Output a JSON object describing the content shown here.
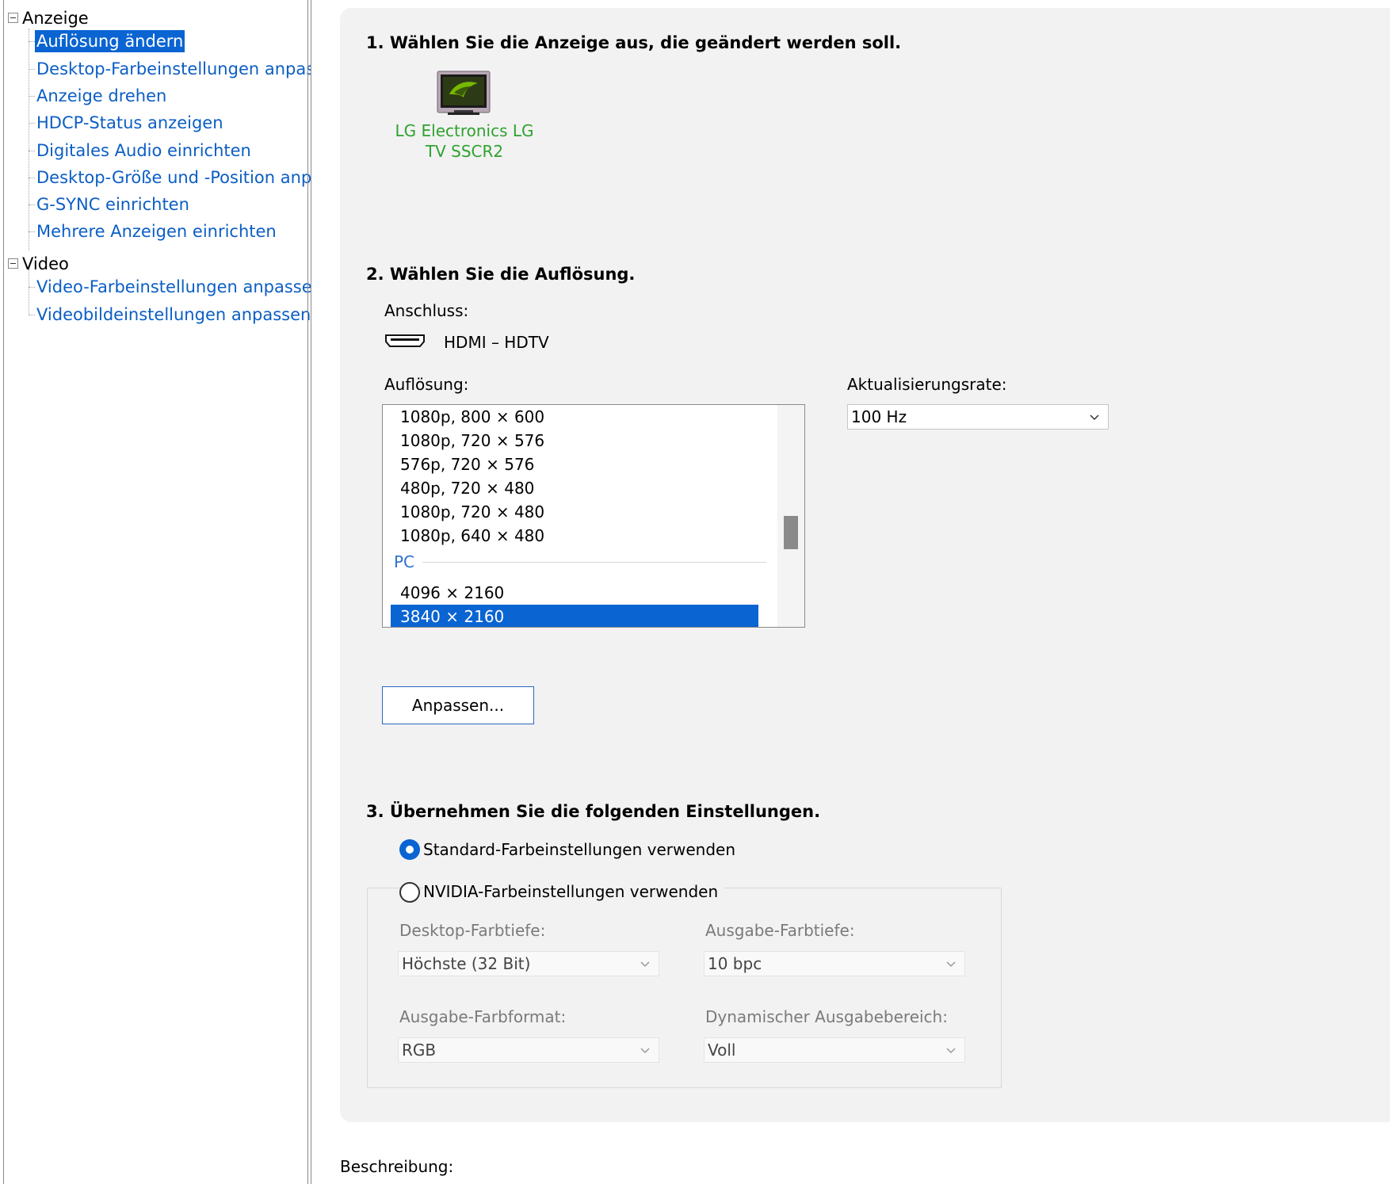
{
  "sidebar": {
    "categories": [
      {
        "label": "Anzeige",
        "items": [
          "Auflösung ändern",
          "Desktop-Farbeinstellungen anpassen",
          "Anzeige drehen",
          "HDCP-Status anzeigen",
          "Digitales Audio einrichten",
          "Desktop-Größe und -Position anpassen",
          "G-SYNC einrichten",
          "Mehrere Anzeigen einrichten"
        ]
      },
      {
        "label": "Video",
        "items": [
          "Video-Farbeinstellungen anpassen",
          "Videobildeinstellungen anpassen"
        ]
      }
    ],
    "selected_item": "Auflösung ändern"
  },
  "step1": {
    "heading": "1. Wählen Sie die Anzeige aus, die geändert werden soll.",
    "display_name_line1": "LG Electronics LG",
    "display_name_line2": "TV SSCR2"
  },
  "step2": {
    "heading": "2. Wählen Sie die Auflösung.",
    "connection_label": "Anschluss:",
    "connection_value": "HDMI – HDTV",
    "resolution_label": "Auflösung:",
    "resolutions": [
      "1080p, 800 × 600",
      "1080p, 720 × 576",
      "576p, 720 × 576",
      "480p, 720 × 480",
      "1080p, 720 × 480",
      "1080p, 640 × 480"
    ],
    "pc_group_label": "PC",
    "pc_resolutions": [
      "4096 × 2160",
      "3840 × 2160"
    ],
    "selected_resolution": "3840 × 2160",
    "refresh_label": "Aktualisierungsrate:",
    "refresh_value": "100 Hz",
    "customize_button": "Anpassen..."
  },
  "step3": {
    "heading": "3. Übernehmen Sie die folgenden Einstellungen.",
    "option_default": "Standard-Farbeinstellungen verwenden",
    "option_nvidia": "NVIDIA-Farbeinstellungen verwenden",
    "selected_option": "default",
    "desktop_depth_label": "Desktop-Farbtiefe:",
    "desktop_depth_value": "Höchste (32 Bit)",
    "output_depth_label": "Ausgabe-Farbtiefe:",
    "output_depth_value": "10 bpc",
    "output_format_label": "Ausgabe-Farbformat:",
    "output_format_value": "RGB",
    "dynamic_range_label": "Dynamischer Ausgabebereich:",
    "dynamic_range_value": "Voll"
  },
  "description_label": "Beschreibung:",
  "colors": {
    "link": "#0b5ec5",
    "selection": "#0a64d2",
    "display_name": "#2ea22e",
    "panel_bg": "#f2f2f2",
    "disabled_text": "#7a7a7a"
  },
  "icons": {
    "tree_expander": "minus-box-icon",
    "monitor": "nvidia-monitor-icon",
    "connector": "hdmi-connector-icon",
    "dropdown": "chevron-down-icon"
  }
}
